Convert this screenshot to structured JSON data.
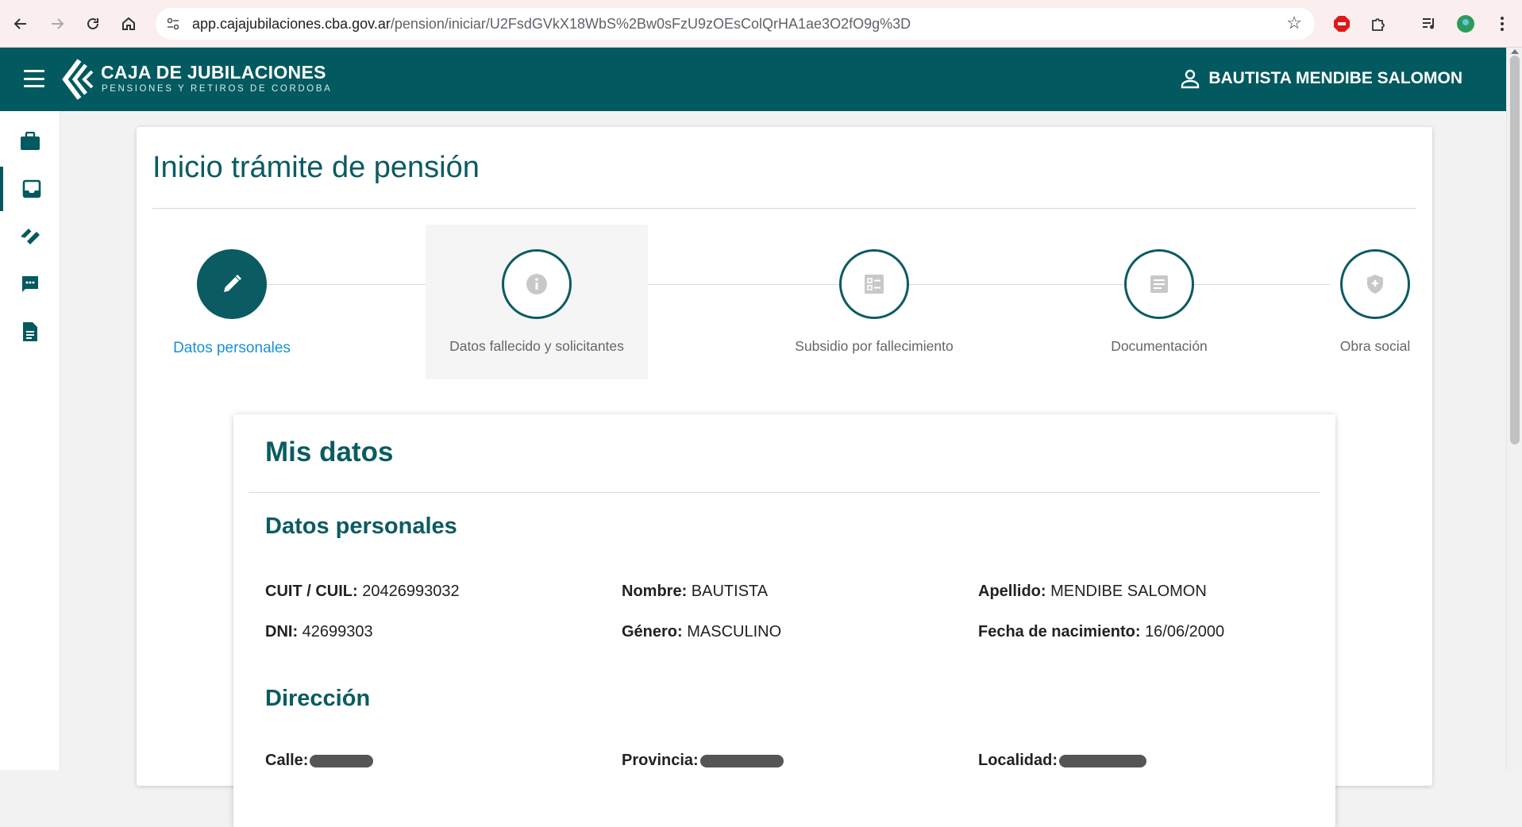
{
  "browser": {
    "url_host": "app.cajajubilaciones.cba.gov.ar",
    "url_path": "/pension/iniciar/U2FsdGVkX18WbS%2Bw0sFzU9zOEsColQrHA1ae3O2fO9g%3D"
  },
  "header": {
    "brand_title": "CAJA DE JUBILACIONES",
    "brand_subtitle": "PENSIONES Y RETIROS DE CORDOBA",
    "user_name": "BAUTISTA MENDIBE SALOMON"
  },
  "page": {
    "title": "Inicio trámite de pensión"
  },
  "stepper": {
    "steps": [
      {
        "label": "Datos personales",
        "icon": "pencil-icon",
        "active": true
      },
      {
        "label": "Datos fallecido y solicitantes",
        "icon": "info-icon",
        "active": false
      },
      {
        "label": "Subsidio por fallecimiento",
        "icon": "list-icon",
        "active": false
      },
      {
        "label": "Documentación",
        "icon": "document-icon",
        "active": false
      },
      {
        "label": "Obra social",
        "icon": "shield-icon",
        "active": false
      }
    ]
  },
  "mis_datos": {
    "title": "Mis datos",
    "personal_section": "Datos personales",
    "cuit_label": "CUIT / CUIL:",
    "cuit_value": "20426993032",
    "nombre_label": "Nombre:",
    "nombre_value": "BAUTISTA",
    "apellido_label": "Apellido:",
    "apellido_value": "MENDIBE SALOMON",
    "dni_label": "DNI:",
    "dni_value": "42699303",
    "genero_label": "Género:",
    "genero_value": "MASCULINO",
    "fecha_label": "Fecha de nacimiento:",
    "fecha_value": "16/06/2000",
    "address_section": "Dirección",
    "calle_label": "Calle:",
    "provincia_label": "Provincia:",
    "localidad_label": "Localidad:"
  },
  "colors": {
    "primary": "#02595f",
    "active_step_label": "#1a8fd6"
  }
}
